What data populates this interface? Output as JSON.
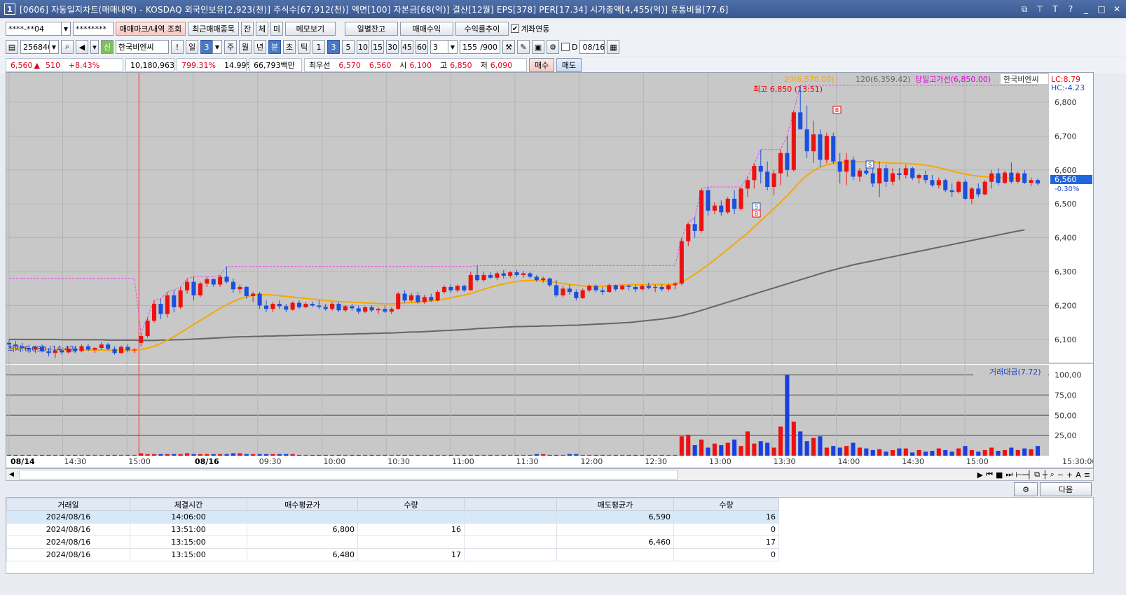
{
  "window": {
    "number": "1",
    "title": "[0606] 자동일지차트(매매내역) - KOSDAQ 외국인보유[2,923(천)] 주식수[67,912(천)] 액면[100] 자본금[68(억)] 결산[12월] EPS[378] PER[17.34] 시가총액[4,455(억)] 유통비율[77.6]"
  },
  "toolbar1": {
    "account": "****-**04",
    "password": "********",
    "trade_mark_btn": "매매마크/내역 조회",
    "recent_btn": "최근매매종목",
    "b_jan": "잔",
    "b_che": "체",
    "b_mi": "미",
    "memo_btn": "메모보기",
    "daily_btn": "일별잔고",
    "profit_btn": "매매수익",
    "rate_btn": "수익률추이",
    "account_link": "계좌연동"
  },
  "toolbar2": {
    "code": "256840",
    "name_badge": "신",
    "name": "한국비엔씨",
    "excl": "!",
    "day_label": "일",
    "day_num": "3",
    "periods": [
      "주",
      "월",
      "년",
      "분",
      "초",
      "틱"
    ],
    "ticks": [
      "1",
      "3",
      "5",
      "10",
      "15",
      "30",
      "45",
      "60"
    ],
    "count": "3",
    "range": "155",
    "range_total": "/900",
    "d_label": "D",
    "date": "08/16"
  },
  "quote": {
    "price": "6,560",
    "change": "510",
    "pct": "+8.43%",
    "volume": "10,180,963",
    "vol_ratio": "799.31%",
    "turnover": "14.99%",
    "amount": "66,793백만",
    "best_label": "최우선",
    "ask": "6,570",
    "bid": "6,560",
    "open_label": "시",
    "open": "6,100",
    "high_label": "고",
    "high": "6,850",
    "low_label": "저",
    "low": "6,090",
    "buy_btn": "매수",
    "sell_btn": "매도"
  },
  "chart_labels": {
    "ma20": "20(6,570.00)",
    "ma120": "120(6,359.42)",
    "today_high_line": "당일고가선(6,850.00)",
    "stock_name": "한국비엔씨",
    "lc": "LC:8.79",
    "hc": "HC:-4.23",
    "high_mark": "최고 6,850 (13:51)",
    "low_mark": "최저 6,030 (14:42)",
    "current_price": "6,560",
    "current_pct": "-0.30%",
    "volume_legend": "거래대금(7.72)",
    "end_time": "15:30:00"
  },
  "chart_data": {
    "type": "candlestick",
    "y_ticks": [
      "6,800",
      "6,700",
      "6,600",
      "6,500",
      "6,400",
      "6,300",
      "6,200",
      "6,100"
    ],
    "vol_ticks": [
      "100,00",
      "75,00",
      "50,00",
      "25,00"
    ],
    "x_ticks": [
      "08/14",
      "14:30",
      "15:00",
      "08/16",
      "09:30",
      "10:00",
      "10:30",
      "11:00",
      "11:30",
      "12:00",
      "12:30",
      "13:00",
      "13:30",
      "14:00",
      "14:30",
      "15:00"
    ],
    "x_ticks_bold": [
      "08/14",
      "08/16"
    ],
    "price_range": [
      6040,
      6870
    ],
    "volume_range": [
      0,
      110
    ],
    "ohlc": [
      [
        6090,
        6100,
        6075,
        6085
      ],
      [
        6085,
        6095,
        6070,
        6080
      ],
      [
        6080,
        6090,
        6065,
        6075
      ],
      [
        6075,
        6085,
        6060,
        6070
      ],
      [
        6070,
        6082,
        6060,
        6078
      ],
      [
        6078,
        6085,
        6062,
        6065
      ],
      [
        6065,
        6075,
        6050,
        6060
      ],
      [
        6060,
        6070,
        6045,
        6068
      ],
      [
        6068,
        6072,
        6055,
        6062
      ],
      [
        6062,
        6078,
        6058,
        6073
      ],
      [
        6073,
        6080,
        6060,
        6066
      ],
      [
        6066,
        6085,
        6062,
        6080
      ],
      [
        6080,
        6088,
        6065,
        6070
      ],
      [
        6070,
        6078,
        6060,
        6075
      ],
      [
        6075,
        6092,
        6070,
        6085
      ],
      [
        6085,
        6090,
        6068,
        6072
      ],
      [
        6072,
        6080,
        6055,
        6060
      ],
      [
        6060,
        6082,
        6058,
        6078
      ],
      [
        6078,
        6085,
        6062,
        6068
      ],
      [
        6068,
        6075,
        6060,
        6070
      ],
      [
        6090,
        6120,
        6080,
        6110
      ],
      [
        6110,
        6165,
        6105,
        6155
      ],
      [
        6155,
        6215,
        6150,
        6205
      ],
      [
        6205,
        6220,
        6160,
        6175
      ],
      [
        6175,
        6240,
        6165,
        6230
      ],
      [
        6230,
        6245,
        6180,
        6195
      ],
      [
        6195,
        6255,
        6190,
        6245
      ],
      [
        6245,
        6280,
        6235,
        6270
      ],
      [
        6270,
        6285,
        6215,
        6230
      ],
      [
        6230,
        6270,
        6225,
        6265
      ],
      [
        6265,
        6285,
        6255,
        6278
      ],
      [
        6278,
        6280,
        6255,
        6262
      ],
      [
        6262,
        6290,
        6255,
        6285
      ],
      [
        6285,
        6315,
        6265,
        6270
      ],
      [
        6270,
        6280,
        6238,
        6248
      ],
      [
        6248,
        6262,
        6235,
        6255
      ],
      [
        6255,
        6258,
        6220,
        6228
      ],
      [
        6228,
        6240,
        6210,
        6235
      ],
      [
        6235,
        6240,
        6190,
        6200
      ],
      [
        6200,
        6215,
        6180,
        6190
      ],
      [
        6190,
        6210,
        6180,
        6205
      ],
      [
        6205,
        6215,
        6190,
        6198
      ],
      [
        6198,
        6205,
        6180,
        6188
      ],
      [
        6188,
        6212,
        6185,
        6208
      ],
      [
        6208,
        6215,
        6190,
        6195
      ],
      [
        6195,
        6210,
        6192,
        6205
      ],
      [
        6205,
        6212,
        6195,
        6200
      ],
      [
        6200,
        6215,
        6190,
        6196
      ],
      [
        6196,
        6205,
        6185,
        6190
      ],
      [
        6190,
        6210,
        6185,
        6205
      ],
      [
        6205,
        6210,
        6180,
        6186
      ],
      [
        6186,
        6202,
        6180,
        6198
      ],
      [
        6198,
        6205,
        6185,
        6192
      ],
      [
        6192,
        6200,
        6175,
        6182
      ],
      [
        6182,
        6198,
        6178,
        6195
      ],
      [
        6195,
        6200,
        6180,
        6186
      ],
      [
        6186,
        6195,
        6175,
        6190
      ],
      [
        6190,
        6200,
        6178,
        6182
      ],
      [
        6182,
        6195,
        6175,
        6190
      ],
      [
        6190,
        6240,
        6188,
        6235
      ],
      [
        6235,
        6245,
        6208,
        6215
      ],
      [
        6215,
        6238,
        6210,
        6230
      ],
      [
        6230,
        6240,
        6205,
        6210
      ],
      [
        6210,
        6232,
        6205,
        6225
      ],
      [
        6225,
        6235,
        6210,
        6215
      ],
      [
        6215,
        6245,
        6212,
        6240
      ],
      [
        6240,
        6260,
        6235,
        6255
      ],
      [
        6255,
        6262,
        6238,
        6245
      ],
      [
        6245,
        6262,
        6240,
        6258
      ],
      [
        6258,
        6262,
        6240,
        6245
      ],
      [
        6245,
        6300,
        6245,
        6290
      ],
      [
        6290,
        6318,
        6270,
        6275
      ],
      [
        6275,
        6300,
        6270,
        6290
      ],
      [
        6290,
        6298,
        6278,
        6282
      ],
      [
        6282,
        6300,
        6275,
        6295
      ],
      [
        6295,
        6305,
        6280,
        6288
      ],
      [
        6288,
        6302,
        6282,
        6298
      ],
      [
        6298,
        6305,
        6285,
        6290
      ],
      [
        6290,
        6302,
        6282,
        6295
      ],
      [
        6295,
        6300,
        6280,
        6285
      ],
      [
        6285,
        6290,
        6270,
        6275
      ],
      [
        6275,
        6285,
        6268,
        6280
      ],
      [
        6280,
        6282,
        6255,
        6260
      ],
      [
        6260,
        6275,
        6225,
        6230
      ],
      [
        6230,
        6258,
        6225,
        6250
      ],
      [
        6250,
        6262,
        6232,
        6240
      ],
      [
        6240,
        6248,
        6215,
        6222
      ],
      [
        6222,
        6250,
        6220,
        6245
      ],
      [
        6245,
        6262,
        6240,
        6258
      ],
      [
        6258,
        6262,
        6238,
        6245
      ],
      [
        6245,
        6255,
        6232,
        6240
      ],
      [
        6240,
        6265,
        6238,
        6260
      ],
      [
        6260,
        6262,
        6242,
        6248
      ],
      [
        6248,
        6262,
        6245,
        6258
      ],
      [
        6258,
        6262,
        6245,
        6255
      ],
      [
        6255,
        6262,
        6240,
        6248
      ],
      [
        6248,
        6262,
        6245,
        6258
      ],
      [
        6258,
        6268,
        6248,
        6252
      ],
      [
        6252,
        6262,
        6240,
        6255
      ],
      [
        6255,
        6262,
        6242,
        6248
      ],
      [
        6248,
        6265,
        6242,
        6260
      ],
      [
        6260,
        6270,
        6248,
        6265
      ],
      [
        6265,
        6400,
        6260,
        6390
      ],
      [
        6390,
        6445,
        6375,
        6440
      ],
      [
        6440,
        6460,
        6400,
        6420
      ],
      [
        6420,
        6545,
        6415,
        6540
      ],
      [
        6540,
        6550,
        6465,
        6480
      ],
      [
        6480,
        6505,
        6470,
        6495
      ],
      [
        6495,
        6510,
        6465,
        6475
      ],
      [
        6475,
        6520,
        6470,
        6515
      ],
      [
        6515,
        6540,
        6470,
        6485
      ],
      [
        6485,
        6550,
        6480,
        6545
      ],
      [
        6545,
        6580,
        6520,
        6570
      ],
      [
        6570,
        6620,
        6545,
        6612
      ],
      [
        6612,
        6660,
        6560,
        6595
      ],
      [
        6595,
        6625,
        6540,
        6550
      ],
      [
        6550,
        6600,
        6525,
        6590
      ],
      [
        6590,
        6660,
        6555,
        6650
      ],
      [
        6650,
        6700,
        6580,
        6600
      ],
      [
        6600,
        6775,
        6595,
        6770
      ],
      [
        6770,
        6850,
        6720,
        6720
      ],
      [
        6720,
        6790,
        6635,
        6655
      ],
      [
        6655,
        6745,
        6620,
        6705
      ],
      [
        6705,
        6720,
        6610,
        6630
      ],
      [
        6630,
        6710,
        6620,
        6700
      ],
      [
        6700,
        6710,
        6618,
        6625
      ],
      [
        6625,
        6650,
        6560,
        6595
      ],
      [
        6595,
        6650,
        6555,
        6630
      ],
      [
        6630,
        6640,
        6570,
        6580
      ],
      [
        6580,
        6605,
        6565,
        6598
      ],
      [
        6598,
        6615,
        6585,
        6590
      ],
      [
        6590,
        6610,
        6550,
        6560
      ],
      [
        6560,
        6625,
        6520,
        6605
      ],
      [
        6605,
        6615,
        6550,
        6565
      ],
      [
        6565,
        6605,
        6555,
        6590
      ],
      [
        6590,
        6605,
        6570,
        6585
      ],
      [
        6585,
        6615,
        6575,
        6605
      ],
      [
        6605,
        6610,
        6570,
        6576
      ],
      [
        6576,
        6590,
        6560,
        6585
      ],
      [
        6585,
        6598,
        6560,
        6570
      ],
      [
        6570,
        6585,
        6550,
        6555
      ],
      [
        6555,
        6578,
        6545,
        6570
      ],
      [
        6570,
        6575,
        6535,
        6540
      ],
      [
        6540,
        6560,
        6520,
        6535
      ],
      [
        6535,
        6570,
        6530,
        6565
      ],
      [
        6565,
        6572,
        6510,
        6515
      ],
      [
        6515,
        6550,
        6500,
        6545
      ],
      [
        6545,
        6560,
        6520,
        6528
      ],
      [
        6528,
        6570,
        6525,
        6565
      ],
      [
        6565,
        6600,
        6545,
        6590
      ],
      [
        6590,
        6605,
        6555,
        6562
      ],
      [
        6562,
        6598,
        6558,
        6592
      ],
      [
        6592,
        6622,
        6560,
        6565
      ],
      [
        6565,
        6595,
        6560,
        6590
      ],
      [
        6590,
        6600,
        6558,
        6562
      ],
      [
        6562,
        6578,
        6552,
        6570
      ],
      [
        6570,
        6575,
        6555,
        6560
      ]
    ],
    "ma_yellow": [
      6075,
      6074,
      6073,
      6073,
      6072,
      6072,
      6071,
      6071,
      6070,
      6070,
      6070,
      6070,
      6069,
      6069,
      6069,
      6068,
      6068,
      6068,
      6068,
      6068,
      6070,
      6074,
      6080,
      6088,
      6098,
      6108,
      6120,
      6132,
      6144,
      6156,
      6168,
      6180,
      6192,
      6202,
      6212,
      6220,
      6226,
      6230,
      6232,
      6232,
      6231,
      6229,
      6227,
      6225,
      6223,
      6221,
      6219,
      6217,
      6215,
      6213,
      6212,
      6211,
      6210,
      6209,
      6208,
      6207,
      6206,
      6205,
      6205,
      6206,
      6208,
      6209,
      6210,
      6212,
      6214,
      6216,
      6219,
      6223,
      6227,
      6231,
      6236,
      6242,
      6248,
      6254,
      6259,
      6264,
      6268,
      6271,
      6273,
      6274,
      6274,
      6273,
      6271,
      6268,
      6265,
      6262,
      6260,
      6258,
      6257,
      6257,
      6257,
      6258,
      6259,
      6260,
      6261,
      6262,
      6262,
      6262,
      6262,
      6262,
      6262,
      6263,
      6270,
      6280,
      6292,
      6306,
      6320,
      6335,
      6350,
      6366,
      6382,
      6398,
      6414,
      6432,
      6450,
      6468,
      6486,
      6505,
      6524,
      6545,
      6566,
      6584,
      6598,
      6608,
      6615,
      6620,
      6622,
      6623,
      6624,
      6624,
      6624,
      6623,
      6622,
      6621,
      6620,
      6620,
      6619,
      6618,
      6616,
      6614,
      6611,
      6607,
      6602,
      6597,
      6592,
      6588,
      6584,
      6582,
      6580,
      6579,
      6578,
      6577,
      6576,
      6575,
      6574
    ],
    "ma_gray": [
      6100,
      6100,
      6100,
      6100,
      6100,
      6100,
      6100,
      6100,
      6099,
      6099,
      6099,
      6099,
      6099,
      6099,
      6099,
      6098,
      6098,
      6098,
      6098,
      6098,
      6097,
      6097,
      6097,
      6098,
      6098,
      6099,
      6099,
      6100,
      6101,
      6102,
      6103,
      6104,
      6105,
      6106,
      6107,
      6108,
      6108,
      6109,
      6109,
      6110,
      6110,
      6111,
      6111,
      6112,
      6112,
      6113,
      6113,
      6114,
      6114,
      6115,
      6115,
      6116,
      6116,
      6117,
      6117,
      6118,
      6118,
      6119,
      6119,
      6120,
      6121,
      6122,
      6122,
      6123,
      6124,
      6125,
      6126,
      6127,
      6128,
      6129,
      6130,
      6132,
      6133,
      6134,
      6135,
      6136,
      6137,
      6138,
      6138,
      6139,
      6139,
      6140,
      6140,
      6141,
      6141,
      6142,
      6142,
      6143,
      6144,
      6145,
      6146,
      6147,
      6148,
      6149,
      6150,
      6152,
      6154,
      6156,
      6158,
      6160,
      6163,
      6166,
      6170,
      6175,
      6180,
      6186,
      6192,
      6198,
      6204,
      6210,
      6216,
      6222,
      6228,
      6234,
      6240,
      6246,
      6252,
      6258,
      6264,
      6270,
      6276,
      6282,
      6288,
      6294,
      6300,
      6305,
      6310,
      6315,
      6320,
      6324,
      6328,
      6332,
      6336,
      6340,
      6344,
      6348,
      6352,
      6356,
      6360,
      6364,
      6368,
      6372,
      6376,
      6380,
      6384,
      6388,
      6392,
      6396,
      6400,
      6404,
      6408,
      6412,
      6416,
      6420,
      6423
    ],
    "volume": [
      1,
      1,
      1,
      1,
      1,
      1,
      1,
      1,
      1,
      1,
      1,
      1,
      1,
      1,
      1,
      1,
      1,
      1,
      1,
      1,
      3,
      2,
      2,
      2,
      2,
      2,
      2,
      3,
      2,
      2,
      2,
      2,
      2,
      2,
      3,
      3,
      2,
      2,
      2,
      2,
      2,
      2,
      2,
      2,
      1,
      1,
      1,
      1,
      1,
      1,
      1,
      1,
      1,
      1,
      1,
      1,
      1,
      1,
      1,
      1,
      1,
      1,
      1,
      1,
      1,
      1,
      1,
      1,
      1,
      1,
      1,
      1,
      1,
      1,
      1,
      1,
      1,
      1,
      1,
      1,
      2,
      2,
      1,
      1,
      1,
      2,
      2,
      1,
      1,
      1,
      1,
      1,
      1,
      1,
      1,
      1,
      1,
      1,
      1,
      1,
      1,
      1,
      24,
      26,
      13,
      20,
      10,
      15,
      13,
      16,
      20,
      12,
      30,
      15,
      18,
      16,
      10,
      36,
      100,
      42,
      30,
      18,
      22,
      24,
      10,
      12,
      10,
      12,
      16,
      10,
      9,
      7,
      8,
      5,
      7,
      9,
      9,
      4,
      7,
      5,
      6,
      9,
      7,
      5,
      9,
      12,
      7,
      5,
      7,
      10,
      6,
      7,
      10,
      7,
      9,
      8,
      12
    ]
  },
  "table": {
    "headers": [
      "거래일",
      "체결시간",
      "매수평균가",
      "수량",
      "",
      "매도평균가",
      "수량"
    ],
    "rows": [
      [
        "2024/08/16",
        "14:06:00",
        "",
        "",
        "",
        "6,590",
        "16"
      ],
      [
        "2024/08/16",
        "13:51:00",
        "6,800",
        "16",
        "",
        "",
        "0"
      ],
      [
        "2024/08/16",
        "13:15:00",
        "",
        "",
        "",
        "6,460",
        "17"
      ],
      [
        "2024/08/16",
        "13:15:00",
        "6,480",
        "17",
        "",
        "",
        "0"
      ]
    ],
    "next_btn": "다음"
  }
}
